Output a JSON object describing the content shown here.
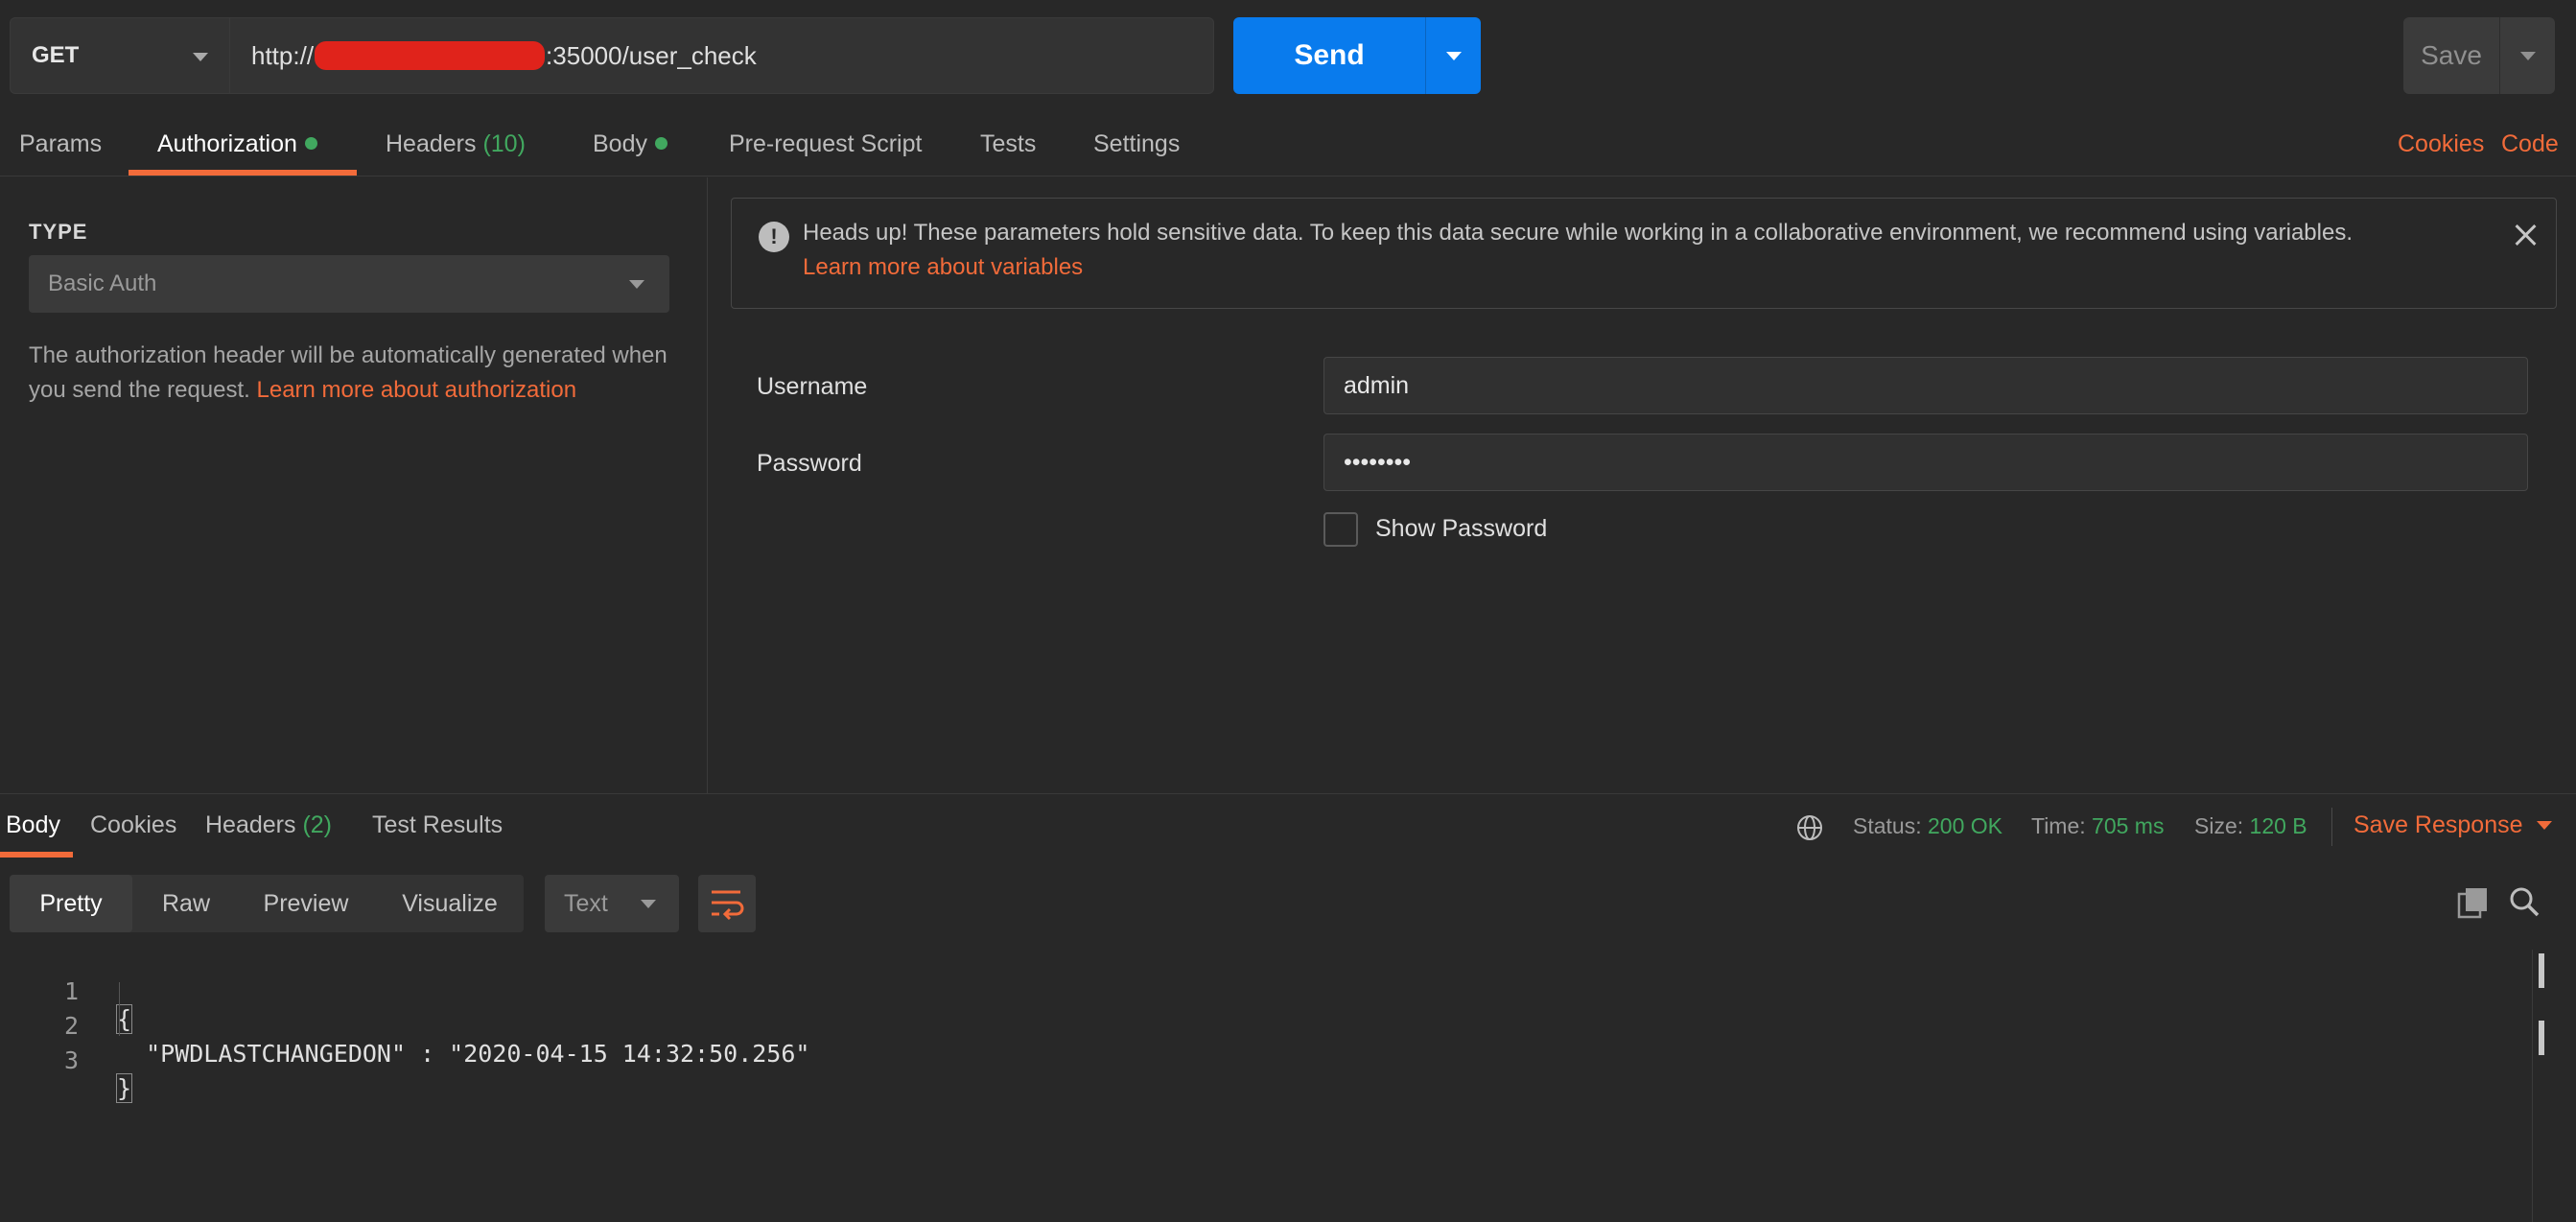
{
  "request": {
    "method": "GET",
    "url_prefix": "http://",
    "url_suffix": ":35000/user_check",
    "send_label": "Send",
    "save_label": "Save"
  },
  "request_tabs": {
    "params": "Params",
    "authorization": "Authorization",
    "headers": "Headers",
    "headers_count": "(10)",
    "body": "Body",
    "pre_request": "Pre-request Script",
    "tests": "Tests",
    "settings": "Settings",
    "cookies": "Cookies",
    "code": "Code"
  },
  "auth": {
    "type_label": "TYPE",
    "type_value": "Basic Auth",
    "desc_text": "The authorization header will be automatically generated when you send the request. ",
    "desc_link": "Learn more about authorization",
    "alert_text": "Heads up! These parameters hold sensitive data. To keep this data secure while working in a collaborative environment, we recommend using variables.",
    "alert_link": "Learn more about variables",
    "username_label": "Username",
    "username_value": "admin",
    "password_label": "Password",
    "password_value": "••••••••",
    "show_password_label": "Show Password"
  },
  "response": {
    "tabs": {
      "body": "Body",
      "cookies": "Cookies",
      "headers": "Headers",
      "headers_count": "(2)",
      "test_results": "Test Results"
    },
    "status_label": "Status:",
    "status_value": "200 OK",
    "time_label": "Time:",
    "time_value": "705 ms",
    "size_label": "Size:",
    "size_value": "120 B",
    "save_response": "Save Response",
    "view_tabs": {
      "pretty": "Pretty",
      "raw": "Raw",
      "preview": "Preview",
      "visualize": "Visualize"
    },
    "format": "Text",
    "lines": [
      {
        "num": "1",
        "text": "{"
      },
      {
        "num": "2",
        "text": "  \"PWDLASTCHANGEDON\" : \"2020-04-15 14:32:50.256\""
      },
      {
        "num": "3",
        "text": "}"
      }
    ]
  },
  "colors": {
    "accent": "#f26b3a",
    "send_blue": "#097bed",
    "success_green": "#41a85f",
    "background": "#282828"
  }
}
